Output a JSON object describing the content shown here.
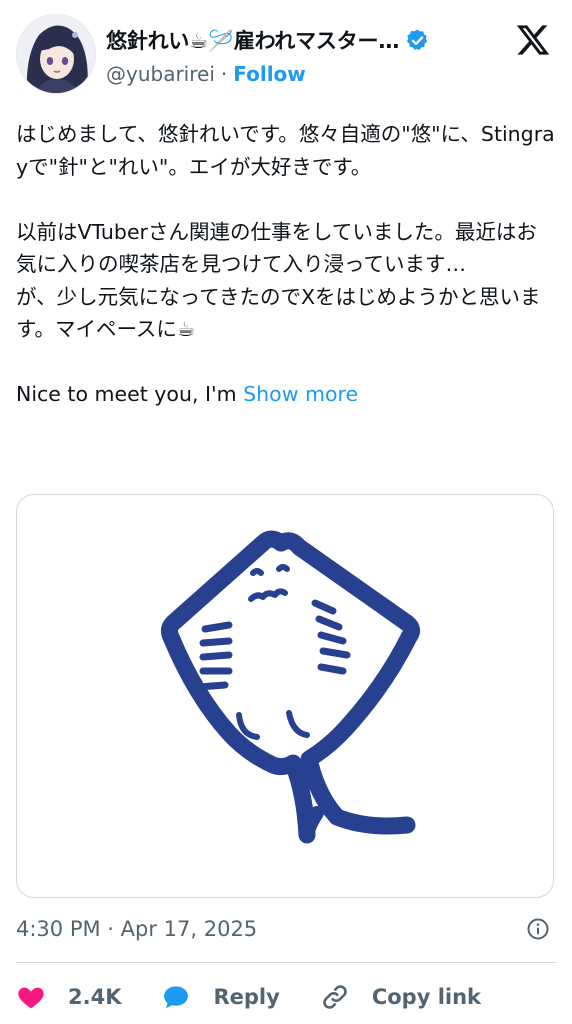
{
  "author": {
    "display_name": "悠針れい☕🪡雇われマスター…",
    "handle": "@yubarirei",
    "separator": "·",
    "follow_label": "Follow",
    "verified": true
  },
  "tweet": {
    "text": "はじめまして、悠針れいです。悠々自適の\"悠\"に、Stingrayで\"針\"と\"れい\"。エイが大好きです。\n\n以前はVTuberさん関連の仕事をしていました。最近はお気に入りの喫茶店を見つけて入り浸っています…\nが、少し元気になってきたのでXをはじめようかと思います。マイペースに☕\n\nNice to meet you, I'm ",
    "show_more_label": "Show more"
  },
  "meta": {
    "timestamp": "4:30 PM · Apr 17, 2025"
  },
  "actions": {
    "like_count": "2.4K",
    "reply_label": "Reply",
    "copy_link_label": "Copy link"
  },
  "colors": {
    "accent": "#1d9bf0",
    "like": "#f91880",
    "reply_bubble": "#1d9bf0",
    "stingray_ink": "#27408f"
  },
  "icons": {
    "verified": "verified-badge-icon",
    "logo": "x-logo-icon",
    "info": "info-icon",
    "like": "heart-icon",
    "reply": "speech-bubble-icon",
    "copy_link": "link-icon"
  }
}
